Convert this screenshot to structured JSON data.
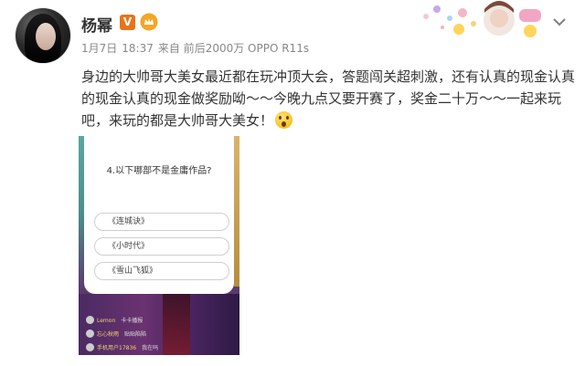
{
  "user": {
    "name": "杨幂",
    "verified_badge": "V",
    "crown_color": "#f5a623",
    "verified_color": "#e8741a"
  },
  "meta": {
    "date": "1月7日",
    "time": "18:37",
    "source": "来自 前后2000万 OPPO R11s"
  },
  "post": {
    "text": "身边的大帅哥大美女最近都在玩冲顶大会，答题闯关超刺激，还有认真的现金认真的现金认真的现金做奖励呦～～今晚九点又要开赛了，奖金二十万～～一起来玩吧，来玩的都是大帅哥大美女！",
    "emoji": "scared-face-icon"
  },
  "quiz": {
    "question": "4.以下哪部不是金庸作品?",
    "options": [
      "《连城诀》",
      "《小时代》",
      "《雪山飞狐》"
    ]
  },
  "comments": [
    {
      "name": "Lemon",
      "text": "卡卡播报"
    },
    {
      "name": "忘心秋雨",
      "text": "贴贴陷陷"
    },
    {
      "name": "手机用户17836",
      "text": "我在吗"
    }
  ]
}
